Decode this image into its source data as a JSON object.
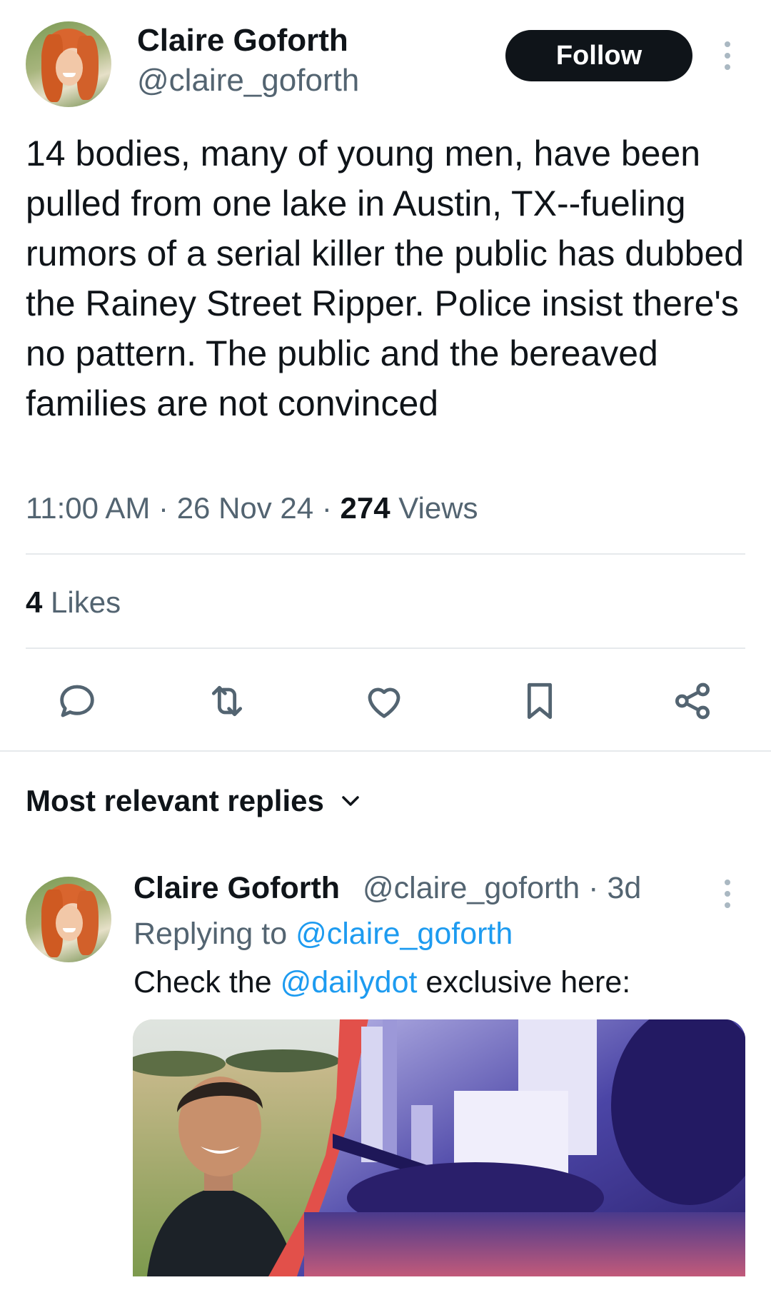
{
  "tweet": {
    "author_name": "Claire Goforth",
    "author_handle": "@claire_goforth",
    "follow_label": "Follow",
    "text": "14 bodies, many of young men, have been pulled from one lake in Austin, TX--fueling rumors of a serial killer the public has dubbed the Rainey Street Ripper. Police insist there's no pattern. The public and the bereaved families are not convinced",
    "time": "11:00 AM",
    "date": "26 Nov 24",
    "views_count": "274",
    "views_label": "Views",
    "separator": "·",
    "likes_count": "4",
    "likes_label": "Likes"
  },
  "actions": {
    "reply_icon": "reply-icon",
    "retweet_icon": "retweet-icon",
    "like_icon": "heart-icon",
    "bookmark_icon": "bookmark-icon",
    "share_icon": "share-icon"
  },
  "replies": {
    "heading": "Most relevant replies",
    "items": [
      {
        "author_name": "Claire Goforth",
        "author_handle": "@claire_goforth",
        "age": "3d",
        "replying_prefix": "Replying to",
        "replying_to": "@claire_goforth",
        "text_before": "Check the",
        "mention": "@dailydot",
        "text_after": "exclusive here:"
      }
    ]
  },
  "colors": {
    "text": "#0f1419",
    "secondary": "#536471",
    "link": "#1d9bf0",
    "divider": "#e6e9ec"
  }
}
